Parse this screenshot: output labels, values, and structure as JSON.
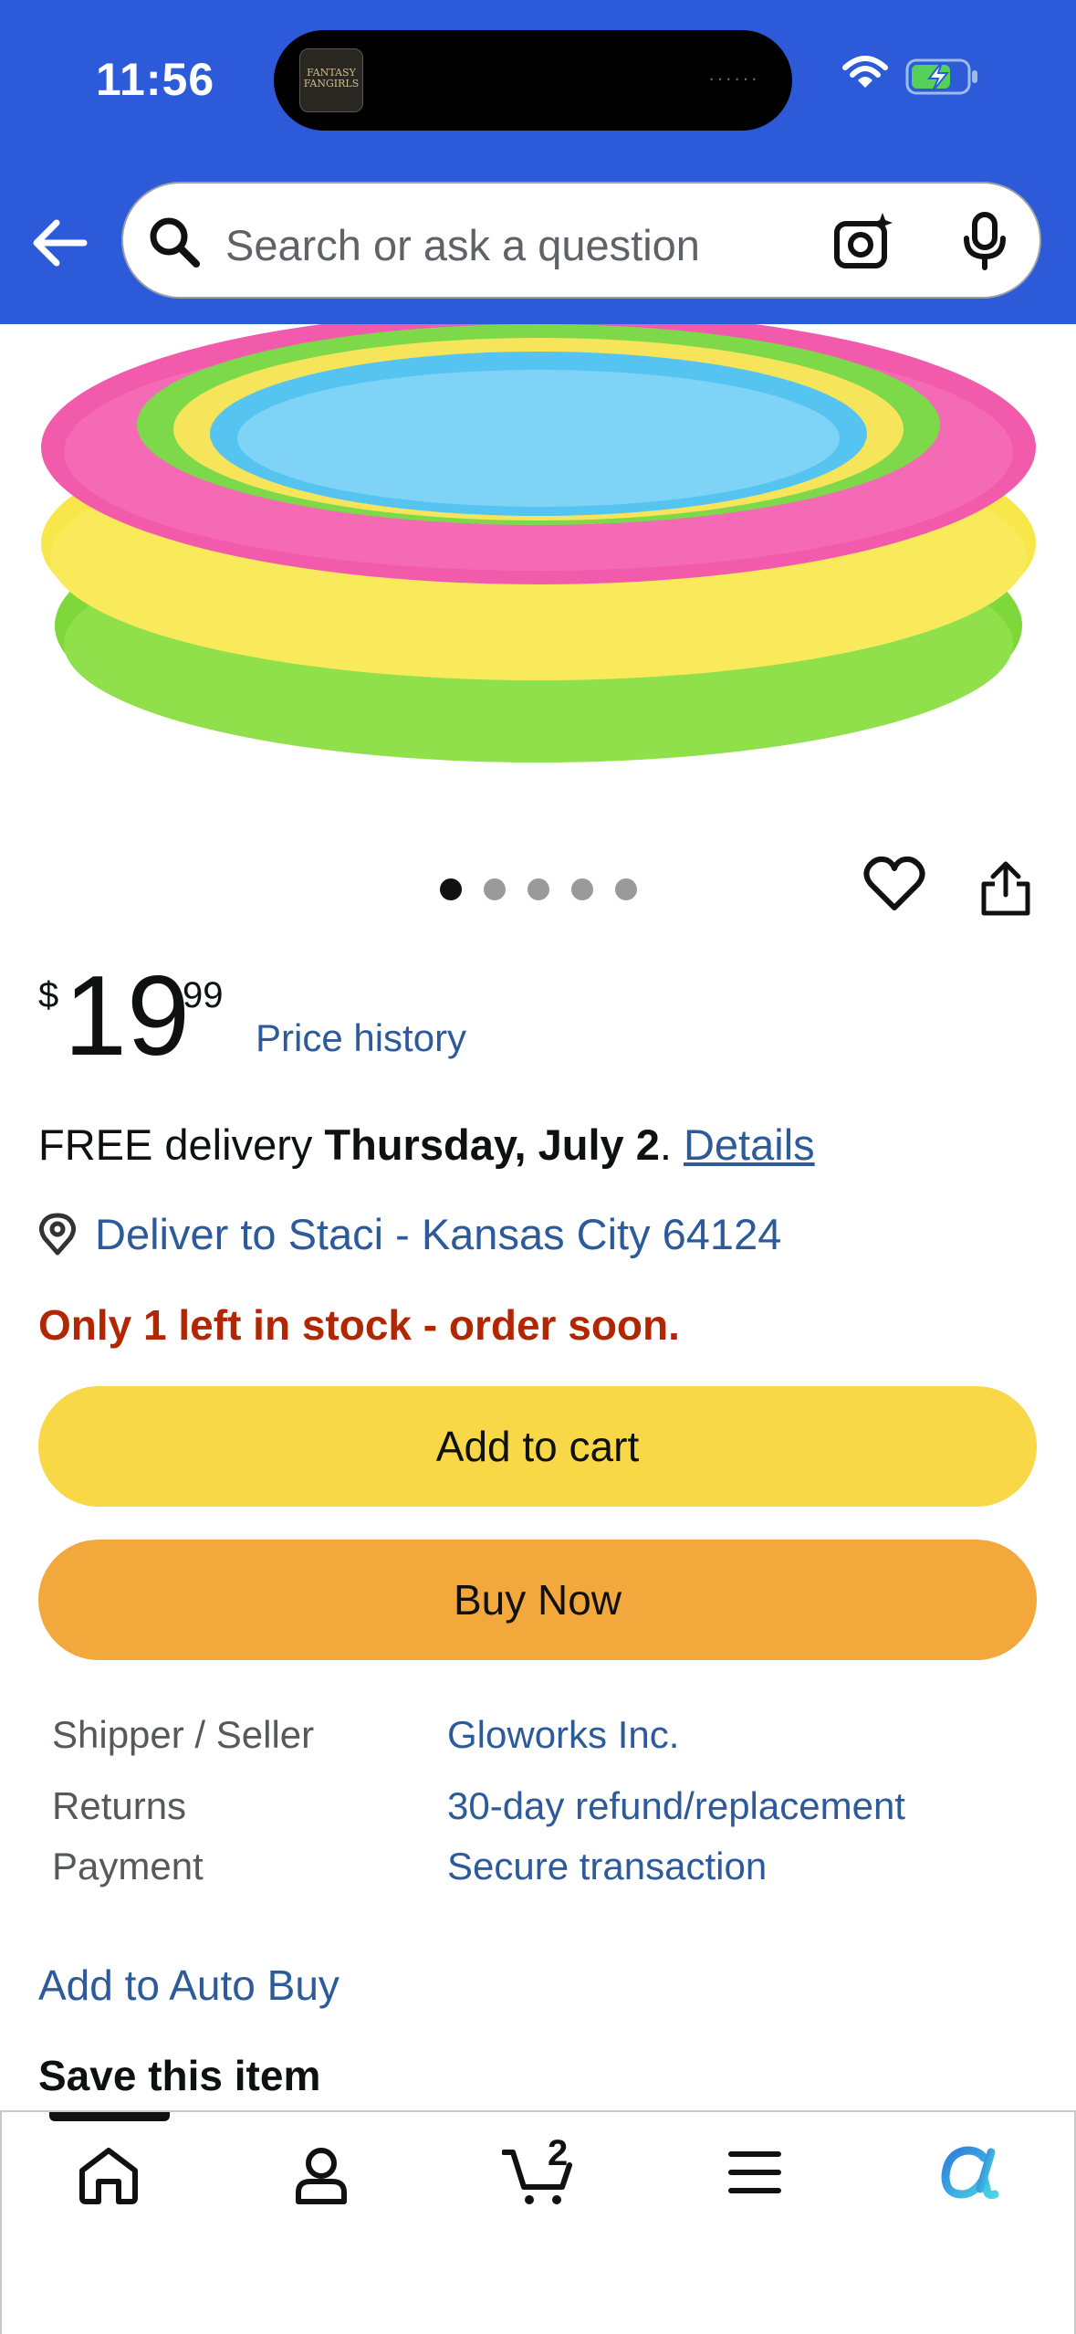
{
  "status_bar": {
    "time": "11:56",
    "app_badge_text": "FANTASY FANGIRLS",
    "island_dots": "······"
  },
  "search": {
    "placeholder": "Search or ask a question"
  },
  "carousel": {
    "total": 5,
    "active_index": 0
  },
  "product": {
    "price_currency": "$",
    "price_whole": "19",
    "price_fraction": "99",
    "price_history_label": "Price history",
    "delivery_prefix": "FREE delivery",
    "delivery_date": "Thursday, July 2",
    "delivery_period": ".",
    "delivery_details_link": "Details",
    "deliver_to": "Deliver to Staci - Kansas City 64124",
    "stock_message": "Only 1 left in stock - order soon.",
    "add_to_cart_label": "Add to cart",
    "buy_now_label": "Buy Now"
  },
  "info_table": [
    {
      "label": "Shipper / Seller",
      "value": "Gloworks Inc."
    },
    {
      "label": "Returns",
      "value": "30-day refund/replacement"
    },
    {
      "label": "Payment",
      "value": "Secure transaction"
    }
  ],
  "auto_buy_label": "Add to Auto Buy",
  "save_item_label": "Save this item",
  "tabbar": {
    "cart_count": "2",
    "items": [
      "home-icon",
      "account-icon",
      "cart-icon",
      "menu-icon",
      "rufus-icon"
    ]
  },
  "colors": {
    "header_blue": "#2d5ad9",
    "add_to_cart": "#f8d846",
    "buy_now": "#f3a83b",
    "link": "#2c5a9a",
    "stock_red": "#b12704"
  }
}
